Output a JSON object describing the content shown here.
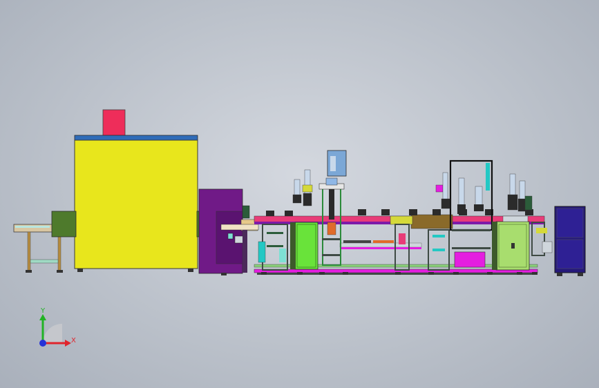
{
  "viewport": {
    "background_top": "#d4d8df",
    "background_bottom": "#a9b0bb"
  },
  "triad": {
    "x_label": "X",
    "y_label": "Y",
    "x_color": "#e0242c",
    "y_color": "#21b324",
    "z_color": "#2432d8"
  },
  "palette": {
    "oven_body": "#e8e61c",
    "oven_roof": "#2f6cb8",
    "exhaust": "#ee2d5a",
    "tunnel_green": "#4e7a2c",
    "purple_cabinet": "#701a87",
    "magenta": "#e41ee0",
    "lime": "#69e33a",
    "pale_green": "#a8dd6e",
    "navy_cabinet": "#25197a",
    "pink_rail": "#e83c78",
    "olive_beam": "#8a6a2a",
    "frame_gray": "#3e4a44",
    "cyan": "#23c8c4"
  }
}
